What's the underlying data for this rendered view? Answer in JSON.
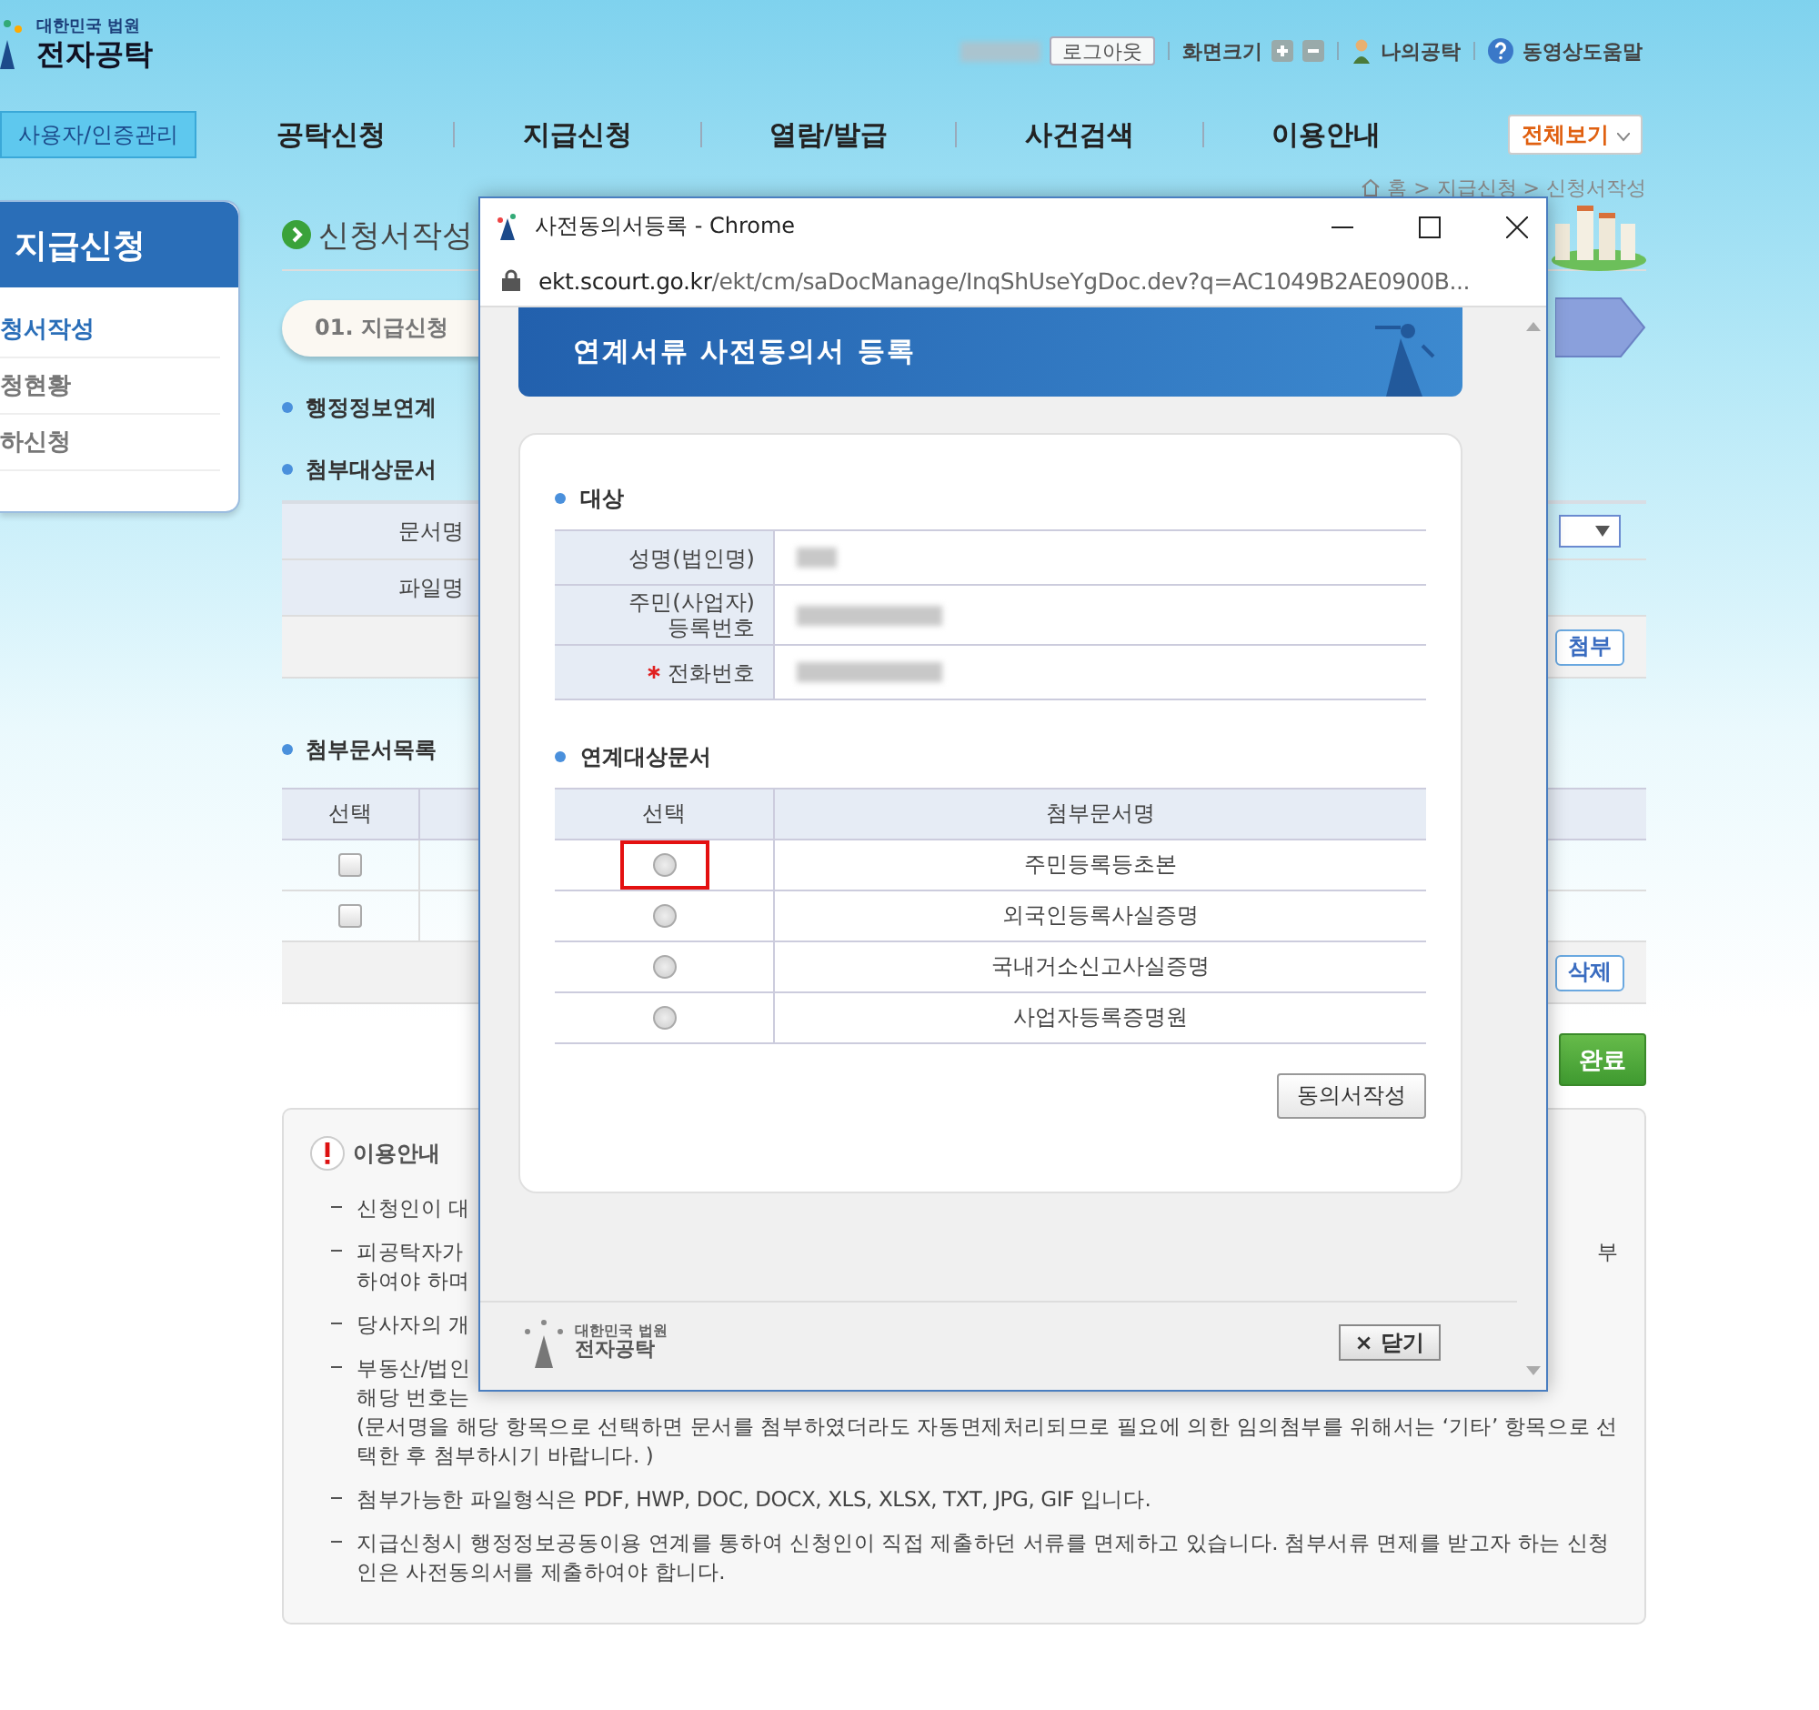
{
  "header": {
    "logo_top": "대한민국 법원",
    "logo_main": "전자공탁",
    "logout": "로그아웃",
    "zoom_label": "화면크기",
    "my_page": "나의공탁",
    "video_help": "동영상도움말"
  },
  "nav": {
    "side_button": "사용자/인증관리",
    "items": [
      "공탁신청",
      "지급신청",
      "열람/발급",
      "사건검색",
      "이용안내"
    ],
    "all_menu": "전체보기"
  },
  "sidebar": {
    "title": "지급신청",
    "items": [
      {
        "label": "청서작성",
        "selected": true
      },
      {
        "label": "청현황",
        "selected": false
      },
      {
        "label": "하신청",
        "selected": false
      }
    ]
  },
  "page": {
    "title": "신청서작성",
    "breadcrumb": "홈 > 지급신청 > 신청서작성",
    "step": "01. 지급신청"
  },
  "link_section": {
    "title": "행정정보연계"
  },
  "attach_section": {
    "title": "첨부대상문서",
    "rows": [
      {
        "label": "문서명",
        "kind": "select"
      },
      {
        "label": "파일명",
        "kind": "text"
      }
    ],
    "attach_button": "첨부"
  },
  "doc_list": {
    "title": "첨부문서목록",
    "select_header": "선택",
    "rows": [
      {
        "checked": false
      },
      {
        "checked": false
      }
    ],
    "delete_button": "삭제",
    "complete_button": "완료"
  },
  "info": {
    "title": "이용안내",
    "items": [
      {
        "lines": [
          {
            "left": "신청인이 대"
          }
        ]
      },
      {
        "lines": [
          {
            "left": "피공탁자가",
            "right": "부"
          },
          {
            "left": "하여야 하며"
          }
        ]
      },
      {
        "lines": [
          {
            "left": "당사자의 개"
          }
        ]
      },
      {
        "lines": [
          {
            "left": "부동산/법인"
          },
          {
            "left": "해당 번호는"
          },
          {
            "left": "(문서명을 해당 항목으로 선택하면 문서를 첨부하였더라도 자동면제처리되므로 필요에 의한 임의첨부를 위해서는 ‘기타’ 항목으로 선택한 후 첨부하시기 바랍니다. )"
          }
        ]
      },
      {
        "lines": [
          {
            "left": "첨부가능한 파일형식은 PDF, HWP, DOC, DOCX, XLS, XLSX, TXT, JPG, GIF 입니다."
          }
        ]
      },
      {
        "lines": [
          {
            "left": "지급신청시 행정정보공동이용 연계를 통하여 신청인이 직접 제출하던 서류를 면제하고 있습니다. 첨부서류 면제를 받고자 하는 신청인은 사전동의서를 제출하여야 합니다."
          }
        ]
      }
    ]
  },
  "popup": {
    "title": "사전동의서등록 - Chrome",
    "url_host": "ekt.scourt.go.kr",
    "url_path": "/ekt/cm/saDocManage/InqShUseYgDoc.dev?q=AC1049B2AE0900B...",
    "banner": "연계서류 사전동의서 등록",
    "target": {
      "title": "대상",
      "fields": [
        {
          "label": "성명(법인명)",
          "required": false
        },
        {
          "label": "주민(사업자)\n등록번호",
          "required": false
        },
        {
          "label": "전화번호",
          "required": true
        }
      ]
    },
    "docs": {
      "title": "연계대상문서",
      "columns": [
        "선택",
        "첨부문서명"
      ],
      "rows": [
        {
          "name": "주민등록등초본",
          "selected": false,
          "highlighted": true
        },
        {
          "name": "외국인등록사실증명",
          "selected": false,
          "highlighted": false
        },
        {
          "name": "국내거소신고사실증명",
          "selected": false,
          "highlighted": false
        },
        {
          "name": "사업자등록증명원",
          "selected": false,
          "highlighted": false
        }
      ]
    },
    "consent_button": "동의서작성",
    "footer_logo_top": "대한민국 법원",
    "footer_logo_main": "전자공탁",
    "close_button": "× 닫기"
  }
}
